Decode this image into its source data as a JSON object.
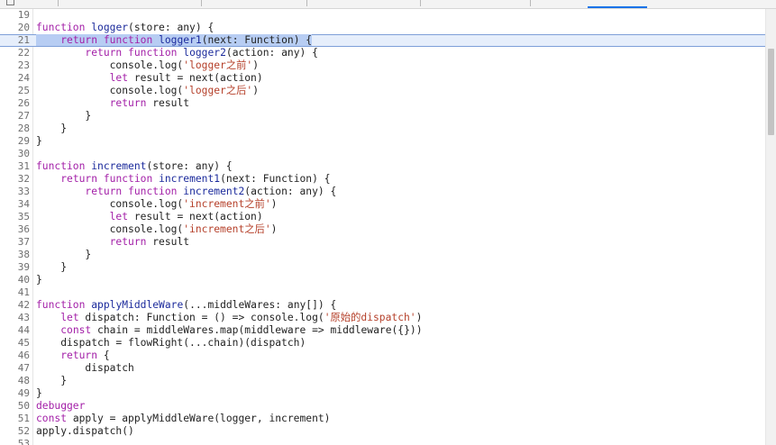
{
  "editor": {
    "lines": [
      {
        "n": "19",
        "text": ""
      },
      {
        "n": "20",
        "text": "function logger(store: any) {"
      },
      {
        "n": "21",
        "text": "    return function logger1(next: Function) {"
      },
      {
        "n": "22",
        "text": "        return function logger2(action: any) {"
      },
      {
        "n": "23",
        "text": "            console.log('logger之前')"
      },
      {
        "n": "24",
        "text": "            let result = next(action)"
      },
      {
        "n": "25",
        "text": "            console.log('logger之后')"
      },
      {
        "n": "26",
        "text": "            return result"
      },
      {
        "n": "27",
        "text": "        }"
      },
      {
        "n": "28",
        "text": "    }"
      },
      {
        "n": "29",
        "text": "}"
      },
      {
        "n": "30",
        "text": ""
      },
      {
        "n": "31",
        "text": "function increment(store: any) {"
      },
      {
        "n": "32",
        "text": "    return function increment1(next: Function) {"
      },
      {
        "n": "33",
        "text": "        return function increment2(action: any) {"
      },
      {
        "n": "34",
        "text": "            console.log('increment之前')"
      },
      {
        "n": "35",
        "text": "            let result = next(action)"
      },
      {
        "n": "36",
        "text": "            console.log('increment之后')"
      },
      {
        "n": "37",
        "text": "            return result"
      },
      {
        "n": "38",
        "text": "        }"
      },
      {
        "n": "39",
        "text": "    }"
      },
      {
        "n": "40",
        "text": "}"
      },
      {
        "n": "41",
        "text": ""
      },
      {
        "n": "42",
        "text": "function applyMiddleWare(...middleWares: any[]) {"
      },
      {
        "n": "43",
        "text": "    let dispatch: Function = () => console.log('原始的dispatch')"
      },
      {
        "n": "44",
        "text": "    const chain = middleWares.map(middleware => middleware({}))"
      },
      {
        "n": "45",
        "text": "    dispatch = flowRight(...chain)(dispatch)"
      },
      {
        "n": "46",
        "text": "    return {"
      },
      {
        "n": "47",
        "text": "        dispatch"
      },
      {
        "n": "48",
        "text": "    }"
      },
      {
        "n": "49",
        "text": "}"
      },
      {
        "n": "50",
        "text": "debugger"
      },
      {
        "n": "51",
        "text": "const apply = applyMiddleWare(logger, increment)"
      },
      {
        "n": "52",
        "text": "apply.dispatch()"
      },
      {
        "n": "53",
        "text": ""
      }
    ],
    "current_line": "21",
    "colors": {
      "keyword": "#a320a8",
      "string": "#b5402a",
      "function_name": "#1c2b9c",
      "selection": "#b7cdf3",
      "current_line_bg": "#e6eefb",
      "tab_active": "#1a73e8"
    }
  }
}
